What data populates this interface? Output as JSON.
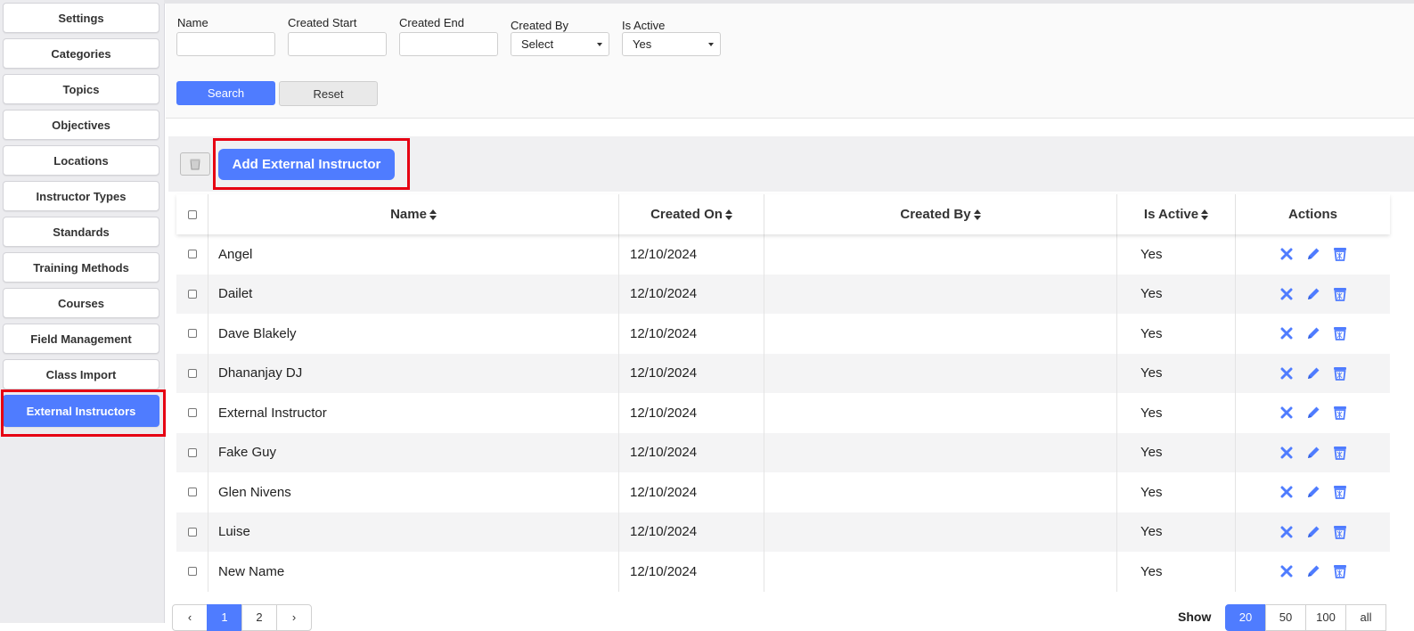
{
  "sidebar": {
    "items": [
      {
        "label": "Settings",
        "active": false
      },
      {
        "label": "Categories",
        "active": false
      },
      {
        "label": "Topics",
        "active": false
      },
      {
        "label": "Objectives",
        "active": false
      },
      {
        "label": "Locations",
        "active": false
      },
      {
        "label": "Instructor Types",
        "active": false
      },
      {
        "label": "Standards",
        "active": false
      },
      {
        "label": "Training Methods",
        "active": false
      },
      {
        "label": "Courses",
        "active": false
      },
      {
        "label": "Field Management",
        "active": false
      },
      {
        "label": "Class Import",
        "active": false
      },
      {
        "label": "External Instructors",
        "active": true
      }
    ]
  },
  "filters": {
    "name_label": "Name",
    "name_value": "",
    "created_start_label": "Created Start",
    "created_start_value": "",
    "created_end_label": "Created End",
    "created_end_value": "",
    "created_by_label": "Created By",
    "created_by_value": "Select",
    "is_active_label": "Is Active",
    "is_active_value": "Yes",
    "search_label": "Search",
    "reset_label": "Reset"
  },
  "toolbar": {
    "add_label": "Add External Instructor",
    "bulk_delete_icon": "trash-icon"
  },
  "table": {
    "columns": [
      "Name",
      "Created On",
      "Created By",
      "Is Active",
      "Actions"
    ],
    "rows": [
      {
        "name": "Angel",
        "created_on": "12/10/2024",
        "created_by": "",
        "is_active": "Yes"
      },
      {
        "name": "Dailet",
        "created_on": "12/10/2024",
        "created_by": "",
        "is_active": "Yes"
      },
      {
        "name": "Dave Blakely",
        "created_on": "12/10/2024",
        "created_by": "",
        "is_active": "Yes"
      },
      {
        "name": "Dhananjay DJ",
        "created_on": "12/10/2024",
        "created_by": "",
        "is_active": "Yes"
      },
      {
        "name": "External Instructor",
        "created_on": "12/10/2024",
        "created_by": "",
        "is_active": "Yes"
      },
      {
        "name": "Fake Guy",
        "created_on": "12/10/2024",
        "created_by": "",
        "is_active": "Yes"
      },
      {
        "name": "Glen Nivens",
        "created_on": "12/10/2024",
        "created_by": "",
        "is_active": "Yes"
      },
      {
        "name": "Luise",
        "created_on": "12/10/2024",
        "created_by": "",
        "is_active": "Yes"
      },
      {
        "name": "New Name",
        "created_on": "12/10/2024",
        "created_by": "",
        "is_active": "Yes"
      }
    ],
    "row_action_icons": [
      "close-icon",
      "pencil-icon",
      "trash-icon"
    ]
  },
  "pagination": {
    "prev": "‹",
    "pages": [
      "1",
      "2"
    ],
    "current": "1",
    "next": "›",
    "show_label": "Show",
    "sizes": [
      "20",
      "50",
      "100",
      "all"
    ],
    "current_size": "20"
  },
  "colors": {
    "accent": "#4f7cff",
    "highlight": "#e60012"
  }
}
